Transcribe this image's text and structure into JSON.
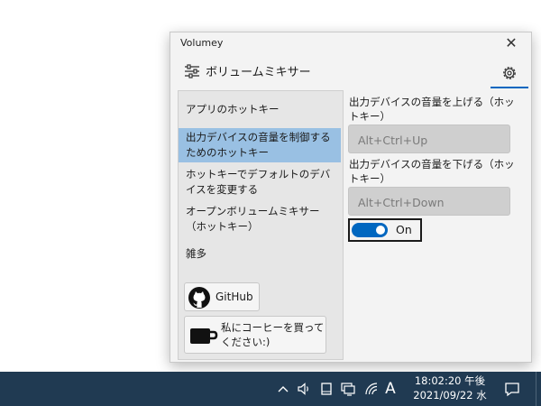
{
  "window": {
    "title": "Volumey",
    "close_glyph": "✕"
  },
  "header": {
    "mixer_label": "ボリュームミキサー",
    "mixer_icon": "mixer-sliders-icon",
    "settings_icon": "gear-icon"
  },
  "sidebar": {
    "items": [
      {
        "label": "アプリのホットキー",
        "selected": false
      },
      {
        "label": "出力デバイスの音量を制御するためのホットキー",
        "selected": true
      },
      {
        "label": "ホットキーでデフォルトのデバイスを変更する",
        "selected": false
      },
      {
        "label": "オープンボリュームミキサー（ホットキー）",
        "selected": false
      },
      {
        "label": "雑多",
        "selected": false
      }
    ],
    "github_label": "GitHub",
    "github_icon": "github-icon",
    "coffee_label": "私にコーヒーを買ってください:)",
    "coffee_icon": "coffee-cup-icon"
  },
  "main": {
    "volume_up_label": "出力デバイスの音量を上げる（ホットキー）",
    "volume_up_value": "Alt+Ctrl+Up",
    "volume_down_label": "出力デバイスの音量を下げる（ホットキー）",
    "volume_down_value": "Alt+Ctrl+Down",
    "toggle_label": "On",
    "toggle_on": true
  },
  "taskbar": {
    "ime_indicator": "A",
    "time": "18:02:20 午後",
    "date": "2021/09/22 水",
    "tray_icons": [
      "chevron-up-icon",
      "speaker-icon",
      "tablet-icon",
      "network-icon",
      "wifi-icon"
    ],
    "notification_icon": "notification-icon"
  },
  "colors": {
    "accent": "#0067c0",
    "selected_item": "#99c0e3",
    "taskbar": "#203a52"
  }
}
